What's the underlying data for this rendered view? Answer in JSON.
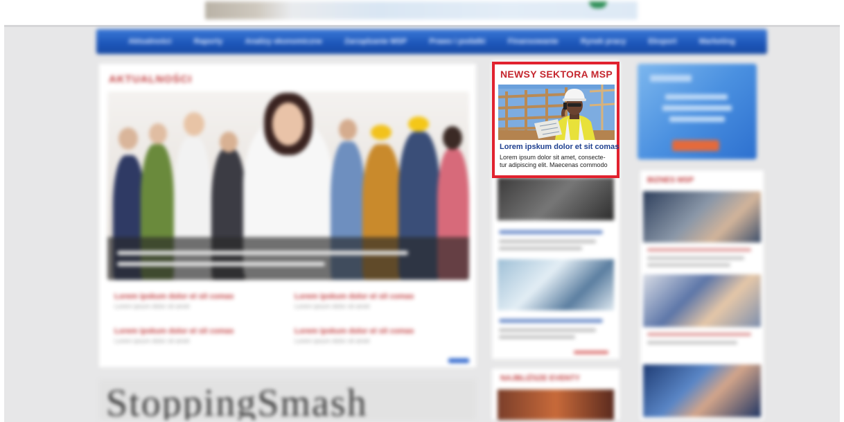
{
  "nav": {
    "items": [
      "Aktualności",
      "Raporty",
      "Analizy ekonomiczne",
      "Zarządzanie MSP",
      "Prawo i podatki",
      "Finansowanie",
      "Rynek pracy",
      "Eksport",
      "Marketing"
    ]
  },
  "featured": {
    "title": "NEWSY SEKTORA MSP",
    "headline": "Lorem ipskum dolor et sit comas",
    "body_lines": [
      "Lorem ipsum dolor sit amet, consecte-",
      "tur adipiscing elit. Maecenas commodo"
    ],
    "accent_color": "#e1222f",
    "headline_color": "#1e3f8f"
  },
  "left": {
    "section_title": "AKTUALNOŚCI",
    "news": [
      {
        "title": "Lorem ipskum dolor et sit comas",
        "desc": "Lorem ipsum dolor sit amet"
      },
      {
        "title": "Lorem ipskum dolor et sit comas",
        "desc": "Lorem ipsum dolor sit amet"
      },
      {
        "title": "Lorem ipskum dolor et sit comas",
        "desc": "Lorem ipsum dolor sit amet"
      },
      {
        "title": "Lorem ipskum dolor et sit comas",
        "desc": "Lorem ipsum dolor sit amet"
      }
    ],
    "bottom_banner": "StoppingSmash"
  },
  "middle": {
    "lower_title": "NAJBLIŻSZE  EVENTY"
  },
  "right": {
    "section_title": "BIZNES MSP"
  },
  "colors": {
    "nav": "#1c55b8",
    "accent_red": "#c0393b",
    "page_bg": "#e7e7e8"
  }
}
